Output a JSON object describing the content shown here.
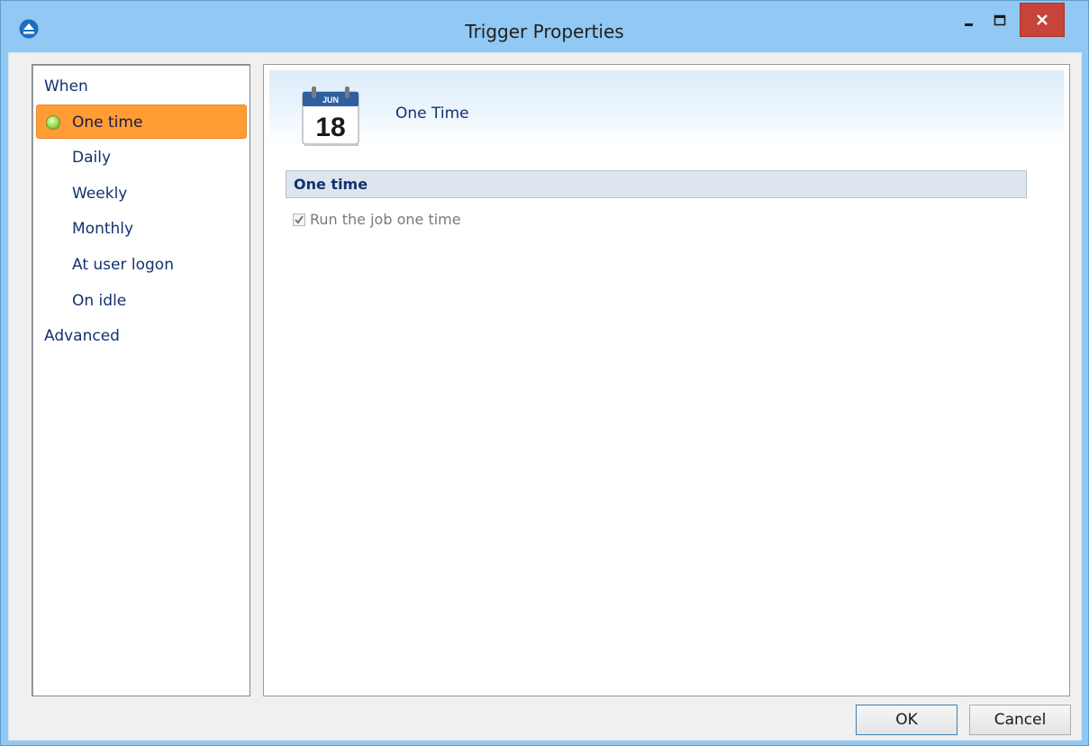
{
  "window": {
    "title": "Trigger Properties",
    "controls": {
      "minimize": "minimize-icon",
      "maximize": "maximize-icon",
      "close": "close-icon"
    }
  },
  "nav": {
    "items": [
      {
        "label": "When",
        "type": "group"
      },
      {
        "label": "One time",
        "type": "child",
        "selected": true
      },
      {
        "label": "Daily",
        "type": "child"
      },
      {
        "label": "Weekly",
        "type": "child"
      },
      {
        "label": "Monthly",
        "type": "child"
      },
      {
        "label": "At user logon",
        "type": "child"
      },
      {
        "label": "On idle",
        "type": "child"
      },
      {
        "label": "Advanced",
        "type": "group"
      }
    ]
  },
  "content": {
    "header_title": "One Time",
    "calendar_icon": {
      "month": "JUN",
      "day": "18"
    },
    "section_title": "One time",
    "run_once_checkbox": {
      "label": "Run the job one time",
      "checked": true,
      "disabled": true
    }
  },
  "buttons": {
    "ok": "OK",
    "cancel": "Cancel"
  },
  "colors": {
    "title_bar": "#91c8f4",
    "selected_item": "#ff9c33",
    "close_button": "#c7443b",
    "nav_text": "#12326e"
  }
}
